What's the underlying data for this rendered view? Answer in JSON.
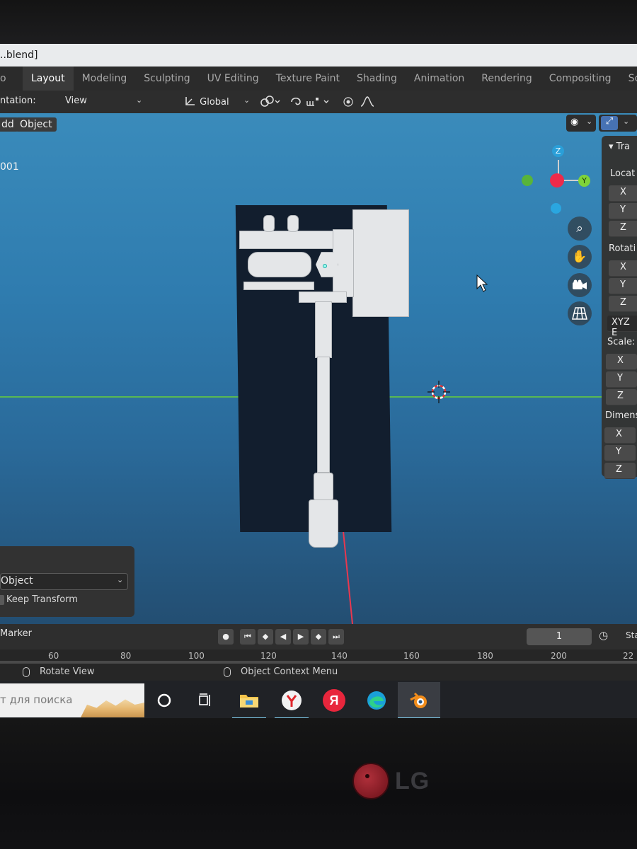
{
  "titlebar": {
    "file_title": "..blend]"
  },
  "workspaces": {
    "left_edge": "o",
    "tabs": [
      "Layout",
      "Modeling",
      "Sculpting",
      "UV Editing",
      "Texture Paint",
      "Shading",
      "Animation",
      "Rendering",
      "Compositing",
      "Scripting"
    ],
    "active": "Layout"
  },
  "header": {
    "orientation_label": "ntation:",
    "orientation_value": "View",
    "transform_space": "Global"
  },
  "viewport": {
    "add_label": "dd",
    "object_label": "Object",
    "frame_label": "001",
    "gizmo": {
      "z": "Z",
      "y": "Y"
    }
  },
  "npanel": {
    "section": "Tra",
    "location_label": "Locat",
    "rotation_label": "Rotati",
    "rotation_mode": "XYZ E",
    "scale_label": "Scale:",
    "dimensions_label": "Dimens",
    "axes": [
      "X",
      "Y",
      "Z"
    ]
  },
  "redo_panel": {
    "select_value": "Object",
    "checkbox_label": "Keep Transform"
  },
  "timeline": {
    "marker_label": "Marker",
    "current_frame": "1",
    "start_label": "Sta",
    "ticks": [
      "60",
      "80",
      "100",
      "120",
      "140",
      "160",
      "180",
      "200",
      "22"
    ]
  },
  "statusbar": {
    "left_hint": "Rotate View",
    "middle_hint": "Object Context Menu"
  },
  "taskbar": {
    "search_placeholder": "т для поиска",
    "yandex_glyph": "Я"
  },
  "monitor": {
    "brand": "LG"
  },
  "colors": {
    "viewport_top": "#3a8bbb",
    "axis_x": "#e8384f",
    "axis_y": "#8bdc00",
    "axis_z": "#2890ff",
    "active_blue": "#4772b3"
  }
}
